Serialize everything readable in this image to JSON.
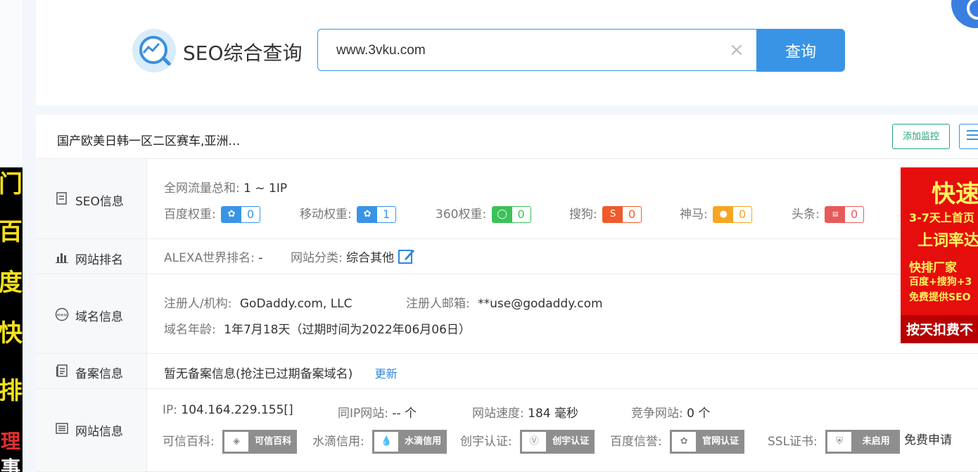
{
  "left_ad": {
    "chars": [
      "门",
      "百",
      "度",
      "快",
      "排",
      "理",
      "事"
    ]
  },
  "header": {
    "brand": "SEO综合查询",
    "search": {
      "value": "www.3vku.com",
      "placeholder": ""
    },
    "search_button": "查询",
    "clear_icon": "×"
  },
  "site": {
    "title": "国产欧美日韩一区二区赛车,亚洲…",
    "add_monitor": "添加监控"
  },
  "seo": {
    "label": "SEO信息",
    "traffic_label": "全网流量总和:",
    "traffic_value": "1 ~ 1IP",
    "weights": [
      {
        "name": "百度权重:",
        "value": "0",
        "color": "#3a94e6",
        "icon": "paw-icon"
      },
      {
        "name": "移动权重:",
        "value": "1",
        "color": "#3a94e6",
        "icon": "paw-icon"
      },
      {
        "name": "360权重:",
        "value": "0",
        "color": "#3cc25a",
        "icon": "360-icon"
      },
      {
        "name": "搜狗:",
        "value": "0",
        "color": "#ef5b2b",
        "icon": "sogou-icon"
      },
      {
        "name": "神马:",
        "value": "0",
        "color": "#f5a623",
        "icon": "shenma-icon"
      },
      {
        "name": "头条:",
        "value": "0",
        "color": "#e85a5a",
        "icon": "toutiao-icon"
      }
    ]
  },
  "rank": {
    "label": "网站排名",
    "alexa_label": "ALEXA世界排名:",
    "alexa_value": "-",
    "category_label": "网站分类:",
    "category_value": "综合其他"
  },
  "domain": {
    "label": "域名信息",
    "registrant_label": "注册人/机构:",
    "registrant_value": "GoDaddy.com, LLC",
    "email_label": "注册人邮箱:",
    "email_value": "**use@godaddy.com",
    "age_label": "域名年龄:",
    "age_value": "1年7月18天（过期时间为2022年06月06日）"
  },
  "icp": {
    "label": "备案信息",
    "text": "暂无备案信息(抢注已过期备案域名)",
    "update": "更新"
  },
  "siteinfo": {
    "label": "网站信息",
    "ip_label": "IP:",
    "ip_value": "104.164.229.155[]",
    "same_ip_label": "同IP网站:",
    "same_ip_value": "-- 个",
    "speed_label": "网站速度:",
    "speed_value": "184 毫秒",
    "competitor_label": "竞争网站:",
    "competitor_value": "0 个",
    "certs": [
      {
        "label": "可信百科:",
        "badge": "可信百科"
      },
      {
        "label": "水滴信用:",
        "badge": "水滴信用"
      },
      {
        "label": "创宇认证:",
        "badge": "创宇认证"
      },
      {
        "label": "百度信誉:",
        "badge": "官网认证"
      },
      {
        "label": "SSL证书:",
        "badge": "未启用"
      }
    ],
    "free_apply": "免费申请"
  },
  "right_ad": {
    "line1": "快速",
    "line2": "3-7天上首页",
    "line3": "上词率达",
    "line4": "快排厂家",
    "line5": "百度+搜狗+3",
    "line6": "免费提供SEO",
    "line7": "按天扣费不"
  }
}
